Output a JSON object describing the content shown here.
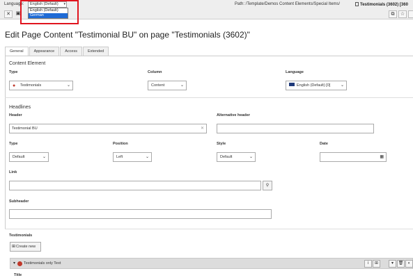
{
  "topbar": {
    "language_label": "Language:",
    "language_selected": "English (Default)",
    "language_options": [
      "English (Default)",
      "German"
    ],
    "path": "Path: /Template/Demos Content Elements/Special Items/",
    "record_title": "Testimonials (3602) [360"
  },
  "page": {
    "title": "Edit Page Content \"Testimonial BU\" on page \"Testimonials (3602)\""
  },
  "tabs": [
    "General",
    "Appearance",
    "Access",
    "Extended"
  ],
  "content_element": {
    "section": "Content Element",
    "type_label": "Type",
    "type_value": "Testimonials",
    "column_label": "Column",
    "column_value": "Content",
    "language_label": "Language",
    "language_value": "English (Default) [0]"
  },
  "headlines": {
    "section": "Headlines",
    "header_label": "Header",
    "header_value": "Testimonial BU",
    "alt_header_label": "Alternative header",
    "alt_header_value": "",
    "type_label": "Type",
    "type_value": "Default",
    "position_label": "Position",
    "position_value": "Left",
    "style_label": "Style",
    "style_value": "Default",
    "date_label": "Date",
    "date_value": "",
    "link_label": "Link",
    "link_value": "",
    "subheader_label": "Subheader",
    "subheader_value": ""
  },
  "testimonials": {
    "label": "Testimonials",
    "create_label": "Create new",
    "item_text": "Testimonials only Text",
    "item_field_title": "Title"
  }
}
